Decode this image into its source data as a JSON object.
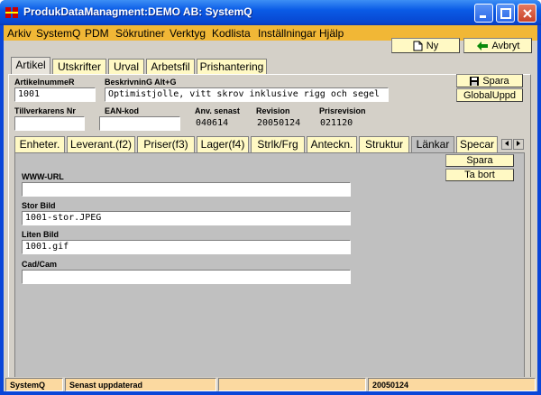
{
  "window": {
    "title": "ProdukDataManagment:DEMO AB: SystemQ"
  },
  "menu": [
    "Arkiv",
    "SystemQ",
    "PDM",
    "Sökrutiner",
    "Verktyg",
    "Kodlista",
    "Inställningar",
    "Hjälp"
  ],
  "toolbar": {
    "new_label": "Ny",
    "cancel_label": "Avbryt"
  },
  "tabs": [
    "Artikel",
    "Utskrifter",
    "Urval",
    "Arbetsfil",
    "Prishantering"
  ],
  "form": {
    "artikelnummer_label": "ArtikelnummeR",
    "artikelnummer_value": "1001",
    "beskrivning_label": "BeskrivninG Alt+G",
    "beskrivning_value": "Optimistjolle, vitt skrov inklusive rigg och segel",
    "save_label": "Spara",
    "globaluppd_label": "GlobalUppd",
    "tillverkare_label": "Tillverkarens Nr",
    "tillverkare_value": "",
    "ean_label": "EAN-kod",
    "ean_value": "",
    "anv_label": "Anv. senast",
    "anv_value": "040614",
    "revision_label": "Revision",
    "revision_value": "20050124",
    "prisrevision_label": "Prisrevision",
    "prisrevision_value": "021120"
  },
  "subtabs": [
    "Enheter.",
    "Leverant.(f2)",
    "Priser(f3)",
    "Lager(f4)",
    "Strlk/Frg",
    "Anteckn.",
    "Struktur",
    "Länkar",
    "Specar"
  ],
  "links": {
    "save_label": "Spara",
    "delete_label": "Ta bort",
    "www_label": "WWW-URL",
    "www_value": "",
    "stor_label": "Stor Bild",
    "stor_value": "1001-stor.JPEG",
    "liten_label": "Liten Bild",
    "liten_value": "1001.gif",
    "cad_label": "Cad/Cam",
    "cad_value": ""
  },
  "status": {
    "app": "SystemQ",
    "message": "Senast uppdaterad",
    "empty": "",
    "date": "20050124"
  }
}
